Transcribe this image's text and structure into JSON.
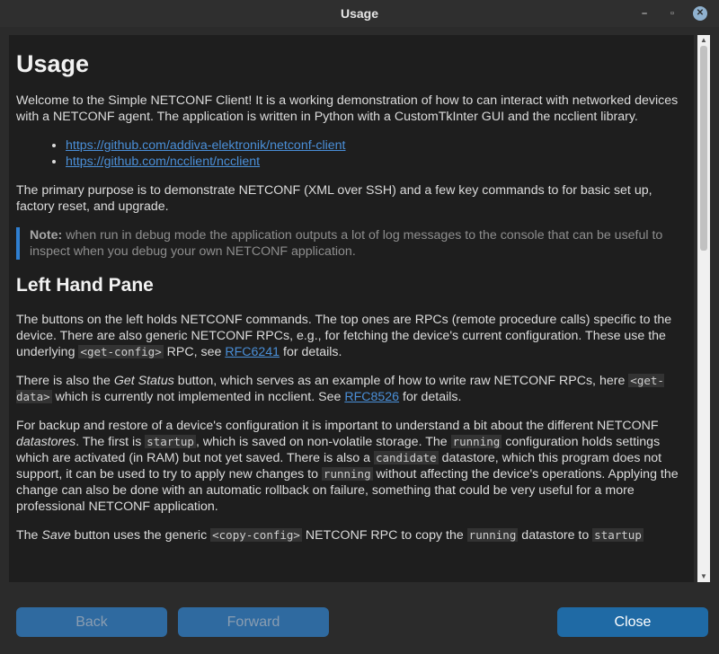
{
  "window": {
    "title": "Usage",
    "minimize_glyph": "–",
    "maximize_glyph": "▫",
    "close_glyph": "✕"
  },
  "doc": {
    "h1": "Usage",
    "intro": "Welcome to the Simple NETCONF Client! It is a working demonstration of how to can interact with networked devices with a NETCONF agent. The application is written in Python with a CustomTkInter GUI and the ncclient library.",
    "links": [
      "https://github.com/addiva-elektronik/netconf-client",
      "https://github.com/ncclient/ncclient"
    ],
    "purpose": "The primary purpose is to demonstrate NETCONF (XML over SSH) and a few key commands to for basic set up, factory reset, and upgrade.",
    "note_label": "Note:",
    "note_text": " when run in debug mode the application outputs a lot of log messages to the console that can be useful to inspect when you debug your own NETCONF application.",
    "h2": "Left Hand Pane",
    "p1_a": "The buttons on the left holds NETCONF commands. The top ones are RPCs (remote procedure calls) specific to the device. There are also generic NETCONF RPCs, e.g., for fetching the device's current configuration. These use the underlying ",
    "p1_code": "<get-config>",
    "p1_b": " RPC, see ",
    "p1_link": "RFC6241",
    "p1_c": " for details.",
    "p2_a": "There is also the ",
    "p2_em": "Get Status",
    "p2_b": " button, which serves as an example of how to write raw NETCONF RPCs, here ",
    "p2_code": "<get-data>",
    "p2_c": " which is currently not implemented in ncclient. See ",
    "p2_link": "RFC8526",
    "p2_d": " for details.",
    "p3_a": "For backup and restore of a device's configuration it is important to understand a bit about the different NETCONF ",
    "p3_em": "datastores",
    "p3_b": ". The first is ",
    "p3_code1": "startup",
    "p3_c": ", which is saved on non-volatile storage. The ",
    "p3_code2": "running",
    "p3_d": " configuration holds settings which are activated (in RAM) but not yet saved. There is also a ",
    "p3_code3": "candidate",
    "p3_e": " datastore, which this program does not support, it can be used to try to apply new changes to ",
    "p3_code4": "running",
    "p3_f": " without affecting the device's operations. Applying the change can also be done with an automatic rollback on failure, something that could be very useful for a more professional NETCONF application.",
    "p4_a": "The ",
    "p4_em": "Save",
    "p4_b": " button uses the generic ",
    "p4_code1": "<copy-config>",
    "p4_c": " NETCONF RPC to copy the ",
    "p4_code2": "running",
    "p4_d": " datastore to ",
    "p4_code3": "startup",
    "p4_e": ""
  },
  "scrollbar": {
    "up_glyph": "▲",
    "down_glyph": "▼"
  },
  "buttons": {
    "back": "Back",
    "forward": "Forward",
    "close": "Close"
  }
}
